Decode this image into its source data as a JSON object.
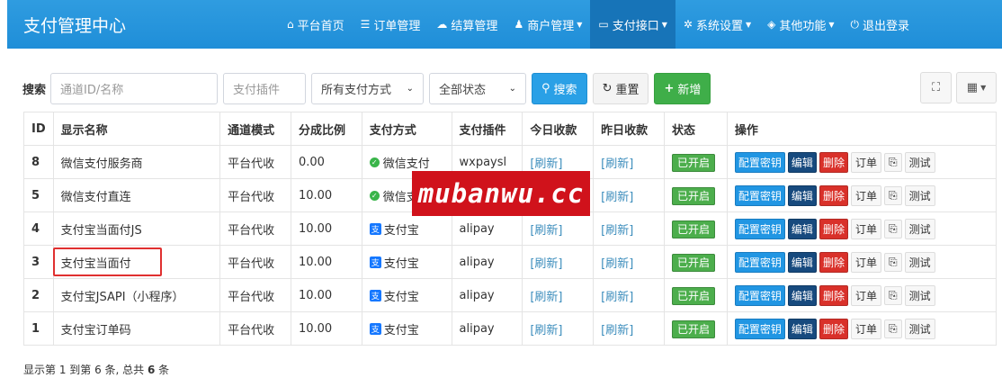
{
  "navbar": {
    "brand": "支付管理中心",
    "items": [
      {
        "icon": "home-icon",
        "glyph": "⌂",
        "label": "平台首页",
        "caret": false,
        "active": false
      },
      {
        "icon": "list-icon",
        "glyph": "☰",
        "label": "订单管理",
        "caret": false,
        "active": false
      },
      {
        "icon": "cloud-icon",
        "glyph": "☁",
        "label": "结算管理",
        "caret": false,
        "active": false
      },
      {
        "icon": "user-icon",
        "glyph": "♟",
        "label": "商户管理",
        "caret": true,
        "active": false
      },
      {
        "icon": "credit-card-icon",
        "glyph": "▭",
        "label": "支付接口",
        "caret": true,
        "active": true
      },
      {
        "icon": "gear-icon",
        "glyph": "✲",
        "label": "系统设置",
        "caret": true,
        "active": false
      },
      {
        "icon": "shield-icon",
        "glyph": "◈",
        "label": "其他功能",
        "caret": true,
        "active": false
      },
      {
        "icon": "power-icon",
        "glyph": "⏻",
        "label": "退出登录",
        "caret": false,
        "active": false
      }
    ]
  },
  "toolbar": {
    "search_label": "搜索",
    "channel_placeholder": "通道ID/名称",
    "plugin_placeholder": "支付插件",
    "pay_type_selected": "所有支付方式",
    "status_selected": "全部状态",
    "search_button": "搜索",
    "reset_button": "重置",
    "add_button": "新增"
  },
  "table": {
    "headers": [
      "ID",
      "显示名称",
      "通道模式",
      "分成比例",
      "支付方式",
      "支付插件",
      "今日收款",
      "昨日收款",
      "状态",
      "操作"
    ],
    "rows": [
      {
        "id": "8",
        "name": "微信支付服务商",
        "mode": "平台代收",
        "ratio": "0.00",
        "pay_type": "微信支付",
        "pay_icon": "wechat",
        "plugin": "wxpaysl",
        "today": "[刷新]",
        "yesterday": "[刷新]",
        "status": "已开启"
      },
      {
        "id": "5",
        "name": "微信支付直连",
        "mode": "平台代收",
        "ratio": "10.00",
        "pay_type": "微信支付",
        "pay_icon": "wechat",
        "plugin": "wxpay",
        "today": "[刷新]",
        "yesterday": "[刷新]",
        "status": "已开启"
      },
      {
        "id": "4",
        "name": "支付宝当面付JS",
        "mode": "平台代收",
        "ratio": "10.00",
        "pay_type": "支付宝",
        "pay_icon": "alipay",
        "plugin": "alipay",
        "today": "[刷新]",
        "yesterday": "[刷新]",
        "status": "已开启"
      },
      {
        "id": "3",
        "name": "支付宝当面付",
        "mode": "平台代收",
        "ratio": "10.00",
        "pay_type": "支付宝",
        "pay_icon": "alipay",
        "plugin": "alipay",
        "today": "[刷新]",
        "yesterday": "[刷新]",
        "status": "已开启"
      },
      {
        "id": "2",
        "name": "支付宝JSAPI（小程序）",
        "mode": "平台代收",
        "ratio": "10.00",
        "pay_type": "支付宝",
        "pay_icon": "alipay",
        "plugin": "alipay",
        "today": "[刷新]",
        "yesterday": "[刷新]",
        "status": "已开启"
      },
      {
        "id": "1",
        "name": "支付宝订单码",
        "mode": "平台代收",
        "ratio": "10.00",
        "pay_type": "支付宝",
        "pay_icon": "alipay",
        "plugin": "alipay",
        "today": "[刷新]",
        "yesterday": "[刷新]",
        "status": "已开启"
      }
    ],
    "actions": {
      "key": "配置密钥",
      "edit": "编辑",
      "delete": "删除",
      "orders": "订单",
      "copy_glyph": "⎘",
      "test": "测试"
    }
  },
  "watermark": "mubanwu.cc",
  "footer": {
    "prefix": "显示第 1 到第 6 条, 总共 ",
    "total": "6",
    "suffix": " 条"
  },
  "colors": {
    "navbar": "#1f8ed8",
    "accent": "#2aa0e6",
    "success": "#4cae4c",
    "danger": "#d9312a",
    "highlight": "#e03030"
  }
}
